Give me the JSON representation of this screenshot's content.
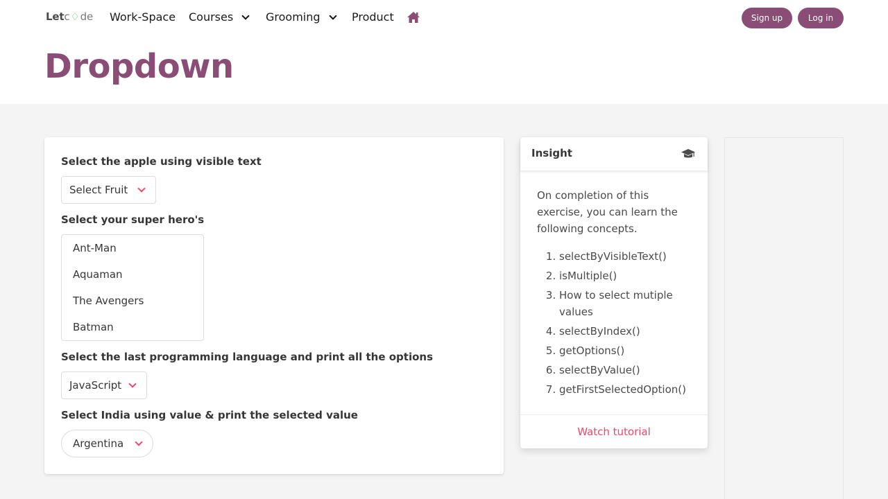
{
  "nav": {
    "logo_part1": "Let",
    "logo_part2": "c",
    "logo_part3": "de",
    "items": [
      {
        "label": "Work-Space"
      },
      {
        "label": "Courses"
      },
      {
        "label": "Grooming"
      },
      {
        "label": "Product"
      }
    ],
    "signup_label": "Sign up",
    "login_label": "Log in"
  },
  "page": {
    "title": "Dropdown"
  },
  "form": {
    "fruit": {
      "label": "Select the apple using visible text",
      "selected": "Select Fruit"
    },
    "heroes": {
      "label": "Select your super hero's",
      "options": [
        "Ant-Man",
        "Aquaman",
        "The Avengers",
        "Batman"
      ]
    },
    "language": {
      "label": "Select the last programming language and print all the options",
      "selected": "JavaScript"
    },
    "country": {
      "label": "Select India using value & print the selected value",
      "selected": "Argentina"
    }
  },
  "insight": {
    "title": "Insight",
    "intro": "On completion of this exercise, you can learn the following concepts.",
    "concepts": [
      "selectByVisibleText()",
      "isMultiple()",
      "How to select mutiple values",
      "selectByIndex()",
      "getOptions()",
      "selectByValue()",
      "getFirstSelectedOption()"
    ],
    "footer_link": "Watch tutorial"
  },
  "colors": {
    "brand": "#8a4d76",
    "accent": "#f14668",
    "logo_code": "#2ecc71"
  },
  "icons": {
    "home": "home-icon",
    "insight": "graduation-cap-icon"
  }
}
